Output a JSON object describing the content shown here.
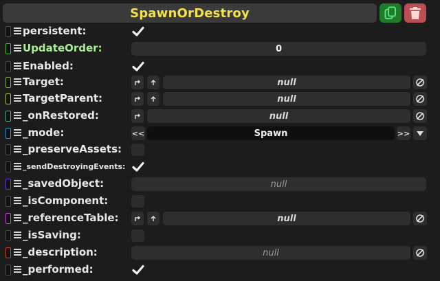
{
  "header": {
    "title": "SpawnOrDestroy",
    "copy_icon": "copy-icon",
    "delete_icon": "trash-icon"
  },
  "colors": {
    "title": "#f3e24a",
    "copy_button": "#1f7a2a",
    "delete_button": "#b94f52",
    "label_highlight": "#a8ec93"
  },
  "fields": [
    {
      "label": "persistent:",
      "chip": "#4a4a4a",
      "kind": "check",
      "checked": true
    },
    {
      "label": "UpdateOrder:",
      "chip": "#3fbf4b",
      "kind": "number",
      "value": "0",
      "highlight": true
    },
    {
      "label": "Enabled:",
      "chip": "#4a4a4a",
      "kind": "check",
      "checked": true
    },
    {
      "label": "Target:",
      "chip": "#7fae3a",
      "kind": "ref2",
      "value": "null"
    },
    {
      "label": "TargetParent:",
      "chip": "#9ed04a",
      "kind": "ref2",
      "value": "null"
    },
    {
      "label": "_onRestored:",
      "chip": "#5fa890",
      "kind": "ref1",
      "value": "null"
    },
    {
      "label": "_mode:",
      "chip": "#3a8fd0",
      "kind": "enum",
      "value": "Spawn",
      "prev": "<<",
      "next": ">>"
    },
    {
      "label": "_preserveAssets:",
      "chip": "#4a4a4a",
      "kind": "check",
      "checked": false
    },
    {
      "label": "_sendDestroyingEvents:",
      "chip": "#4a4a4a",
      "kind": "check",
      "checked": true,
      "small": true
    },
    {
      "label": "_savedObject:",
      "chip": "#6a3ad0",
      "kind": "plain",
      "value": "null"
    },
    {
      "label": "_isComponent:",
      "chip": "#4a4a4a",
      "kind": "check",
      "checked": false
    },
    {
      "label": "_referenceTable:",
      "chip": "#c04ad0",
      "kind": "ref2",
      "value": "null"
    },
    {
      "label": "_isSaving:",
      "chip": "#4a4a4a",
      "kind": "check",
      "checked": false
    },
    {
      "label": "_description:",
      "chip": "#d03a3a",
      "kind": "text",
      "value": "null"
    },
    {
      "label": "_performed:",
      "chip": "#4a4a4a",
      "kind": "check",
      "checked": true
    }
  ]
}
